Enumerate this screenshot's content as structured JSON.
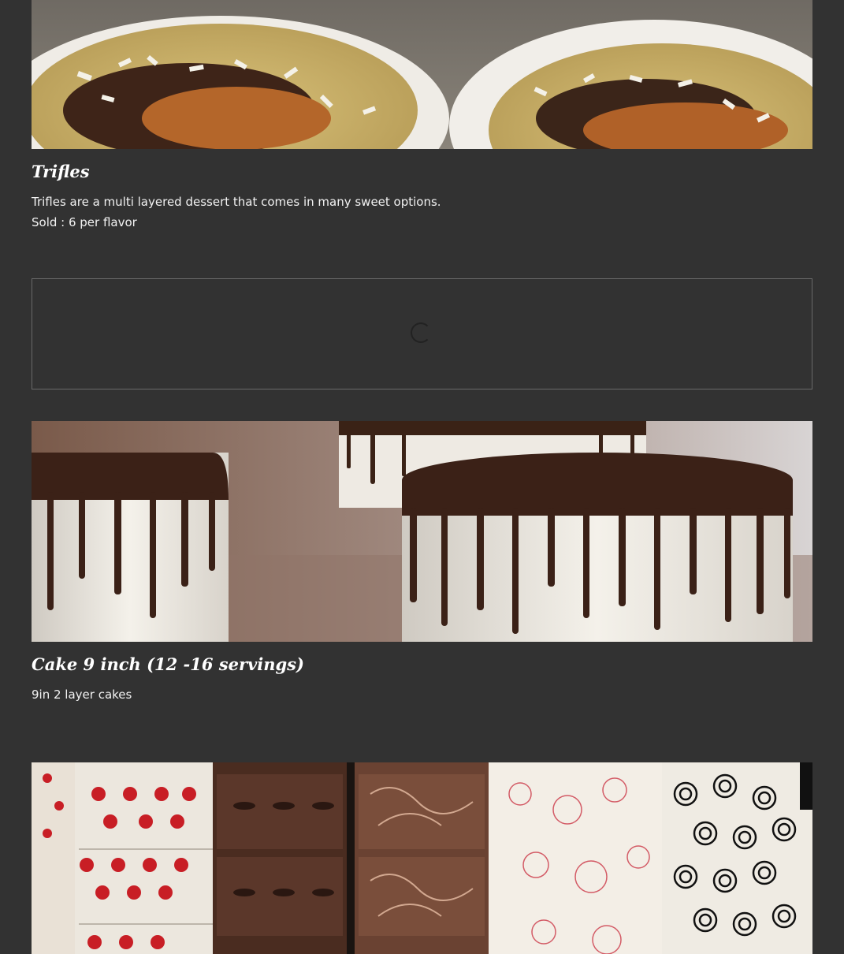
{
  "products": [
    {
      "image_alt": "trifle-bowls-photo",
      "title": "Trifles",
      "description_lines": [
        "Trifles are a multi layered dessert that comes in many sweet options.",
        "Sold : 6 per flavor"
      ]
    },
    {
      "image_alt": "drip-cakes-photo",
      "title": "Cake 9 inch (12 -16 servings)",
      "description_lines": [
        "9in 2 layer cakes"
      ]
    },
    {
      "image_alt": "decorated-chocolates-photo"
    }
  ],
  "loading": {
    "icon": "spinner-icon"
  },
  "colors": {
    "background": "#323232",
    "text": "#ffffff",
    "border": "#6a6a6a"
  }
}
